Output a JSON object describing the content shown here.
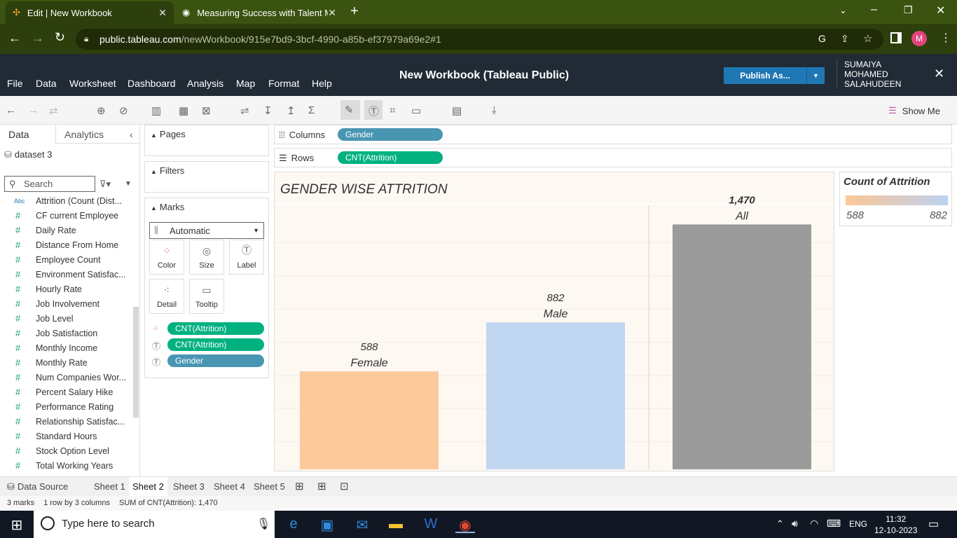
{
  "browser": {
    "tabs": [
      {
        "title": "Edit | New Workbook",
        "active": true
      },
      {
        "title": "Measuring Success with Talent M",
        "active": false
      }
    ],
    "url_host": "public.tableau.com",
    "url_path": "/newWorkbook/915e7bd9-3bcf-4990-a85b-ef37979a69e2#1",
    "profile_initial": "M"
  },
  "header": {
    "menu": [
      "File",
      "Data",
      "Worksheet",
      "Dashboard",
      "Analysis",
      "Map",
      "Format",
      "Help"
    ],
    "title": "New Workbook (Tableau Public)",
    "publish_label": "Publish As...",
    "user_name": "SUMAIYA MOHAMED SALAHUDEEN"
  },
  "toolbar": {
    "show_me": "Show Me"
  },
  "left_pane": {
    "tab_data": "Data",
    "tab_analytics": "Analytics",
    "datasource": "dataset 3",
    "search_placeholder": "Search",
    "fields": [
      {
        "type": "Abc",
        "name": "Attrition (Count (Dist..."
      },
      {
        "type": "#",
        "name": "CF current Employee"
      },
      {
        "type": "#",
        "name": "Daily Rate"
      },
      {
        "type": "#",
        "name": "Distance From Home"
      },
      {
        "type": "#",
        "name": "Employee Count"
      },
      {
        "type": "#",
        "name": "Environment Satisfac..."
      },
      {
        "type": "#",
        "name": "Hourly Rate"
      },
      {
        "type": "#",
        "name": "Job Involvement"
      },
      {
        "type": "#",
        "name": "Job Level"
      },
      {
        "type": "#",
        "name": "Job Satisfaction"
      },
      {
        "type": "#",
        "name": "Monthly Income"
      },
      {
        "type": "#",
        "name": "Monthly Rate"
      },
      {
        "type": "#",
        "name": "Num Companies Wor..."
      },
      {
        "type": "#",
        "name": "Percent Salary Hike"
      },
      {
        "type": "#",
        "name": "Performance Rating"
      },
      {
        "type": "#",
        "name": "Relationship Satisfac..."
      },
      {
        "type": "#",
        "name": "Standard Hours"
      },
      {
        "type": "#",
        "name": "Stock Option Level"
      },
      {
        "type": "#",
        "name": "Total Working Years"
      }
    ]
  },
  "cards": {
    "pages": "Pages",
    "filters": "Filters",
    "marks": "Marks",
    "mark_type": "Automatic",
    "buttons": [
      "Color",
      "Size",
      "Label",
      "Detail",
      "Tooltip"
    ],
    "pills": [
      "CNT(Attrition)",
      "CNT(Attrition)",
      "Gender"
    ]
  },
  "shelves": {
    "columns_label": "Columns",
    "columns_pill": "Gender",
    "rows_label": "Rows",
    "rows_pill": "CNT(Attrition)"
  },
  "chart_data": {
    "type": "bar",
    "title": "GENDER WISE ATTRITION",
    "categories": [
      "Female",
      "Male",
      "All"
    ],
    "values": [
      588,
      882,
      1470
    ],
    "value_labels": [
      "588",
      "882",
      "1,470"
    ],
    "colors": [
      "#fcc99c",
      "#c1d6f1",
      "#9b9b9b"
    ],
    "ylim": [
      0,
      1560
    ],
    "legend": {
      "title": "Count of Attrition",
      "min": "588",
      "max": "882",
      "placement": "right"
    }
  },
  "sheet_tabs": {
    "data_source": "Data Source",
    "sheets": [
      "Sheet 1",
      "Sheet 2",
      "Sheet 3",
      "Sheet 4",
      "Sheet 5"
    ],
    "active": "Sheet 2"
  },
  "status": {
    "marks": "3 marks",
    "layout": "1 row by 3 columns",
    "sum": "SUM of CNT(Attrition): 1,470"
  },
  "taskbar": {
    "search_placeholder": "Type here to search",
    "language": "ENG",
    "time": "11:32",
    "date": "12-10-2023"
  }
}
